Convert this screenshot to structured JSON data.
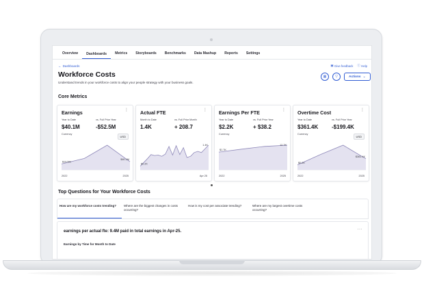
{
  "nav": {
    "tabs": [
      {
        "label": "Overview"
      },
      {
        "label": "Dashboards",
        "active": true
      },
      {
        "label": "Metrics"
      },
      {
        "label": "Storyboards"
      },
      {
        "label": "Benchmarks"
      },
      {
        "label": "Data Mashup"
      },
      {
        "label": "Reports"
      },
      {
        "label": "Settings"
      }
    ]
  },
  "breadcrumb": {
    "back_label": "Dashboards"
  },
  "header": {
    "give_feedback": "Give feedback",
    "help": "Help",
    "title": "Workforce Costs",
    "subtitle": "Understand trends in your workforce costs to align your people strategy with your business goals.",
    "actions_label": "Actions"
  },
  "core_metrics": {
    "section_title": "Core Metrics",
    "cards": [
      {
        "title": "Earnings",
        "col1_label": "Year to Date",
        "col1_value": "$40.1M",
        "col2_label": "vs. Full Prior Year",
        "col2_value": "-$52.5M",
        "unit_label": "Currency",
        "unit_pill": "USD",
        "chart_data": {
          "type": "area",
          "x": [
            2022,
            2023,
            2024,
            2025
          ],
          "values": [
            0.24,
            0.46,
            1.0,
            0.33
          ],
          "start_label": "$19.5M",
          "end_label": "$40.1M",
          "x_start": "2022",
          "x_end": "2025"
        }
      },
      {
        "title": "Actual FTE",
        "col1_label": "Month to Date",
        "col1_value": "1.4K",
        "col2_label": "vs. Full Prior Month",
        "col2_value": "+ 208.7",
        "unit_label": "",
        "unit_pill": "",
        "chart_data": {
          "type": "area",
          "x": [
            1,
            2,
            3,
            4,
            5,
            6,
            7,
            8,
            9,
            10,
            11,
            12,
            13,
            14,
            15,
            16,
            17,
            18,
            19,
            20
          ],
          "values": [
            0.15,
            0.3,
            0.45,
            0.62,
            0.58,
            0.6,
            0.55,
            0.64,
            0.95,
            0.6,
            0.98,
            0.62,
            0.9,
            0.5,
            0.55,
            0.7,
            0.75,
            0.7,
            0.85,
            1.0
          ],
          "start_label": "$0.2K",
          "end_label": "1.4K",
          "x_start": "",
          "x_end": "Apr 25"
        }
      },
      {
        "title": "Earnings Per FTE",
        "col1_label": "Year to Date",
        "col1_value": "$2.2K",
        "col2_label": "vs. Full Prior Year",
        "col2_value": "+ $38.2",
        "unit_label": "Currency",
        "unit_pill": "",
        "chart_data": {
          "type": "area",
          "x": [
            2022,
            2023,
            2024,
            2025
          ],
          "values": [
            0.72,
            0.84,
            0.95,
            1.0
          ],
          "start_label": "$1.7K",
          "end_label": "12.7K",
          "x_start": "2022",
          "x_end": "2025"
        }
      },
      {
        "title": "Overtime Cost",
        "col1_label": "Year to Date",
        "col1_value": "$361.4K",
        "col2_label": "vs. Full Prior Year",
        "col2_value": "-$199.4K",
        "unit_label": "Currency",
        "unit_pill": "USD",
        "chart_data": {
          "type": "area",
          "x": [
            2022,
            2023,
            2024,
            2025
          ],
          "values": [
            0.2,
            0.62,
            1.0,
            0.45
          ],
          "start_label": "$0.2K",
          "end_label": "$361.4K",
          "x_start": "2022",
          "x_end": "2025"
        }
      }
    ]
  },
  "top_questions": {
    "section_title": "Top Questions for Your Workforce Costs",
    "tabs": [
      {
        "label": "How are my workforce costs trending?",
        "active": true
      },
      {
        "label": "Where are the biggest changes in costs occurring?"
      },
      {
        "label": "How is my cost per associate trending?"
      },
      {
        "label": "Where are my largest overtime costs occurring?"
      }
    ]
  },
  "insight": {
    "text": "earnings per actual fte: 9.4M paid in total earnings in Apr-25.",
    "subtitle": "Earnings by Time for Month to Date"
  },
  "colors": {
    "accent": "#2f5bd3",
    "area_fill": "#e4e2f0",
    "area_line": "#8d87b8"
  }
}
